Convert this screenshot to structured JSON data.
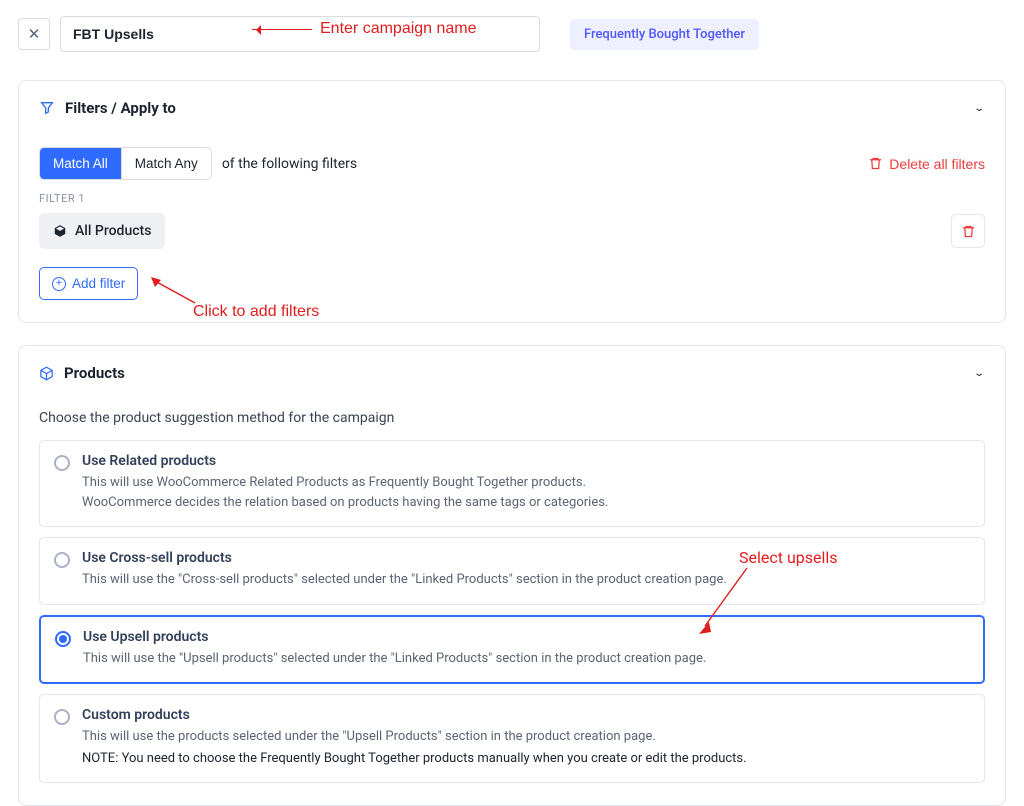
{
  "header": {
    "campaign_name": "FBT Upsells",
    "badge": "Frequently Bought Together"
  },
  "annotations": {
    "enter_name": "Enter campaign name",
    "add_filters": "Click to add filters",
    "select_upsells": "Select upsells"
  },
  "filters_card": {
    "title": "Filters / Apply to",
    "match_all": "Match All",
    "match_any": "Match Any",
    "suffix": "of the following filters",
    "delete_all": "Delete all filters",
    "filter_label": "FILTER 1",
    "chip": "All Products",
    "add_filter": "Add filter"
  },
  "products_card": {
    "title": "Products",
    "desc": "Choose the product suggestion method for the campaign",
    "options": [
      {
        "title": "Use Related products",
        "desc": "This will use WooCommerce Related Products as Frequently Bought Together products.\nWooCommerce decides the relation based on products having the same tags or categories."
      },
      {
        "title": "Use Cross-sell products",
        "desc": "This will use the \"Cross-sell products\" selected under the \"Linked Products\" section in the product creation page."
      },
      {
        "title": "Use Upsell products",
        "desc": "This will use the \"Upsell products\" selected under the \"Linked Products\" section in the product creation page."
      },
      {
        "title": "Custom products",
        "desc": "This will use the products selected under the \"Upsell Products\" section in the product creation page.",
        "note": "NOTE: You need to choose the Frequently Bought Together products manually when you create or edit the products."
      }
    ],
    "selected_index": 2
  }
}
